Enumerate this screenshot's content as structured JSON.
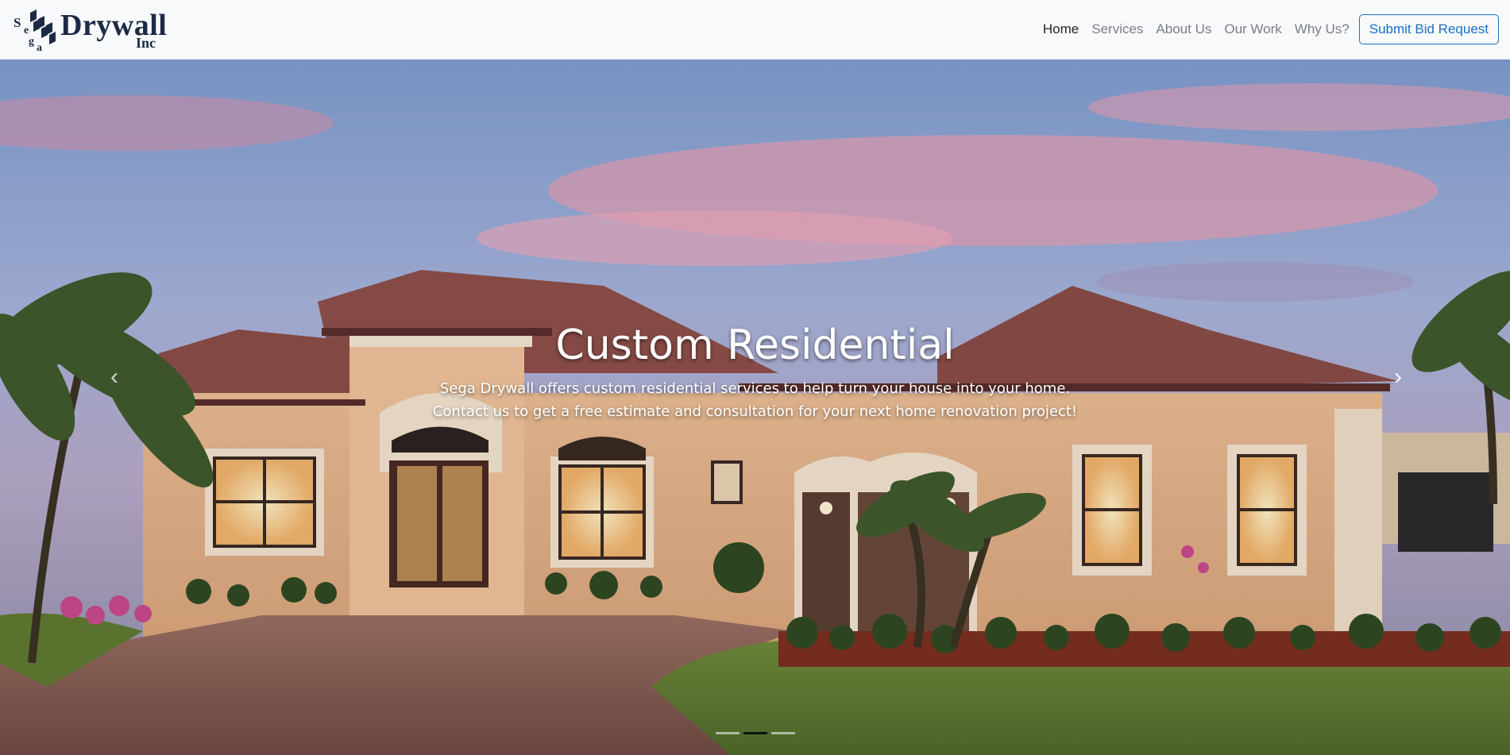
{
  "brand": {
    "name": "Drywall",
    "suffix": "Inc",
    "mark_letters": [
      "S",
      "e",
      "g",
      "a"
    ],
    "color": "#1c2a45"
  },
  "nav": {
    "items": [
      {
        "label": "Home",
        "active": true
      },
      {
        "label": "Services",
        "active": false
      },
      {
        "label": "About Us",
        "active": false
      },
      {
        "label": "Our Work",
        "active": false
      },
      {
        "label": "Why Us?",
        "active": false
      }
    ],
    "cta_label": "Submit Bid Request",
    "cta_color": "#1b6fc4"
  },
  "hero": {
    "title": "Custom Residential",
    "line1": "Sega Drywall offers custom residential services to help turn your house into your home.",
    "line2": "Contact us to get a free estimate and consultation for your next home renovation project!",
    "prev_icon": "chevron-left-icon",
    "next_icon": "chevron-right-icon",
    "prev_glyph": "‹",
    "next_glyph": "›",
    "slide_count": 3,
    "active_slide": 2
  }
}
